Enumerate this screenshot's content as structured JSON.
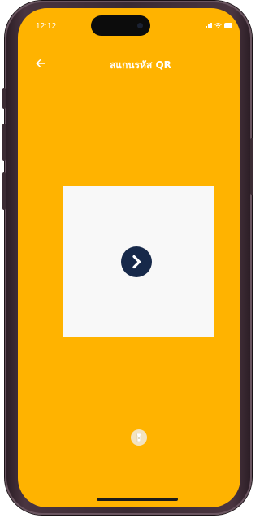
{
  "status_bar": {
    "time": "12:12",
    "icons": [
      "signal-icon",
      "wifi-icon",
      "battery-icon"
    ]
  },
  "header": {
    "title": "สแกนรหัส QR",
    "back_icon": "back-arrow-icon"
  },
  "scanner": {
    "next_icon": "chevron-right-icon"
  },
  "footer": {
    "flash_icon": "flashlight-icon"
  },
  "colors": {
    "background": "#FFB300",
    "scan_area": "#F8F8F8",
    "accent": "#17294A",
    "text": "#FFFFFF"
  }
}
